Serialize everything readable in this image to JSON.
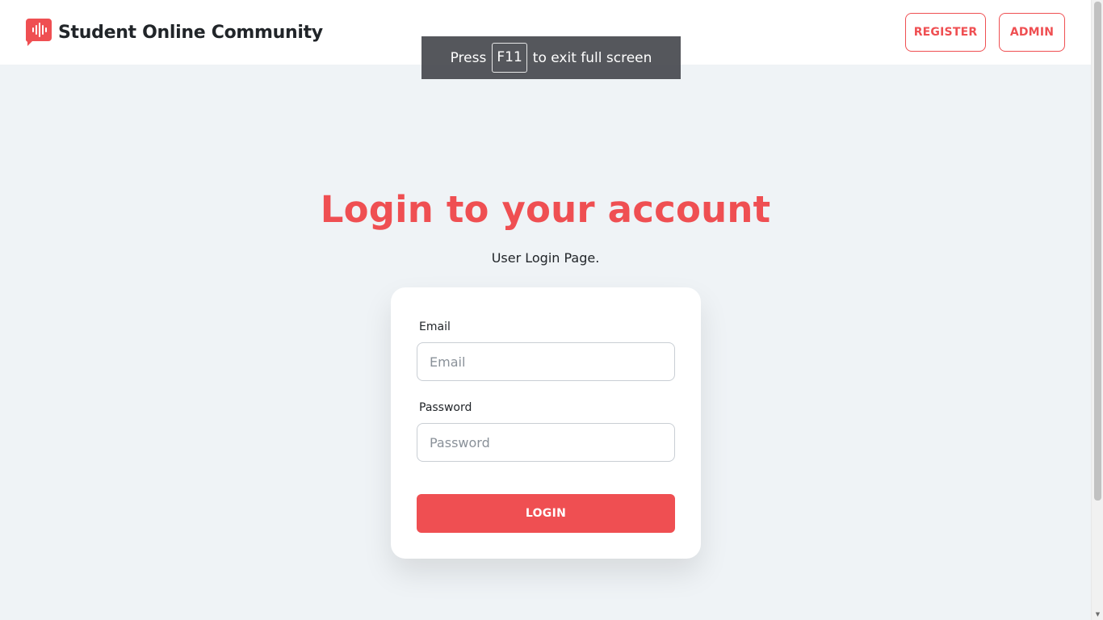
{
  "app": {
    "brand_name": "Student Online Community",
    "brand_color": "#ef4f52"
  },
  "nav": {
    "register_label": "REGISTER",
    "admin_label": "ADMIN"
  },
  "fullscreen_toast": {
    "prefix": "Press",
    "key": "F11",
    "suffix": "to exit full screen"
  },
  "main": {
    "title": "Login to your account",
    "subtitle": "User Login Page."
  },
  "form": {
    "email_label": "Email",
    "email_placeholder": "Email",
    "email_value": "",
    "password_label": "Password",
    "password_placeholder": "Password",
    "password_value": "",
    "submit_label": "LOGIN"
  },
  "icons": {
    "brand_logo": "audio-wave-chat-icon",
    "scroll_up": "chevron-up-icon",
    "scroll_down": "chevron-down-icon"
  }
}
